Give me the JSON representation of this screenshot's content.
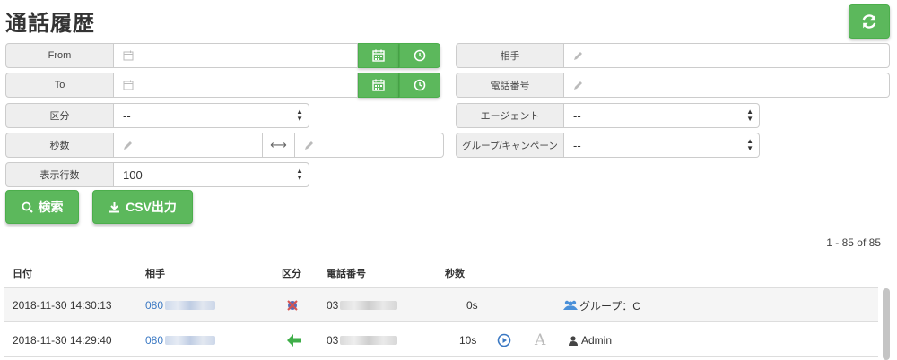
{
  "page": {
    "title": "通話履歴"
  },
  "toolbar": {
    "refresh_icon": "refresh-icon"
  },
  "form": {
    "from": {
      "label": "From",
      "value": ""
    },
    "to": {
      "label": "To",
      "value": ""
    },
    "category": {
      "label": "区分",
      "value": "--"
    },
    "seconds": {
      "label": "秒数",
      "range_symbol": "⟷"
    },
    "rows_per_page": {
      "label": "表示行数",
      "value": "100"
    },
    "partner": {
      "label": "相手",
      "value": ""
    },
    "phone": {
      "label": "電話番号",
      "value": ""
    },
    "agent": {
      "label": "エージェント",
      "value": "--"
    },
    "group": {
      "label": "グループ/キャンペーン",
      "value": "--"
    }
  },
  "actions": {
    "search_label": "検索",
    "csv_label": "CSV出力"
  },
  "results": {
    "count_text": "1 - 85 of 85"
  },
  "table": {
    "headers": {
      "date": "日付",
      "partner": "相手",
      "category": "区分",
      "phone": "電話番号",
      "seconds": "秒数"
    },
    "rows": [
      {
        "date": "2018-11-30 14:30:13",
        "partner_prefix": "080",
        "phone_prefix": "03",
        "seconds": "0s",
        "category_icon": "missed-call-icon",
        "agent": "グループ：C",
        "agent_icon": "group-icon"
      },
      {
        "date": "2018-11-30 14:29:40",
        "partner_prefix": "080",
        "phone_prefix": "03",
        "seconds": "10s",
        "category_icon": "incoming-call-icon",
        "agent": "Admin",
        "agent_icon": "user-icon"
      }
    ]
  },
  "colors": {
    "accent": "#5cb85c",
    "link": "#3a78c3",
    "missed": "#5b6bb5",
    "incoming": "#3fae49"
  }
}
